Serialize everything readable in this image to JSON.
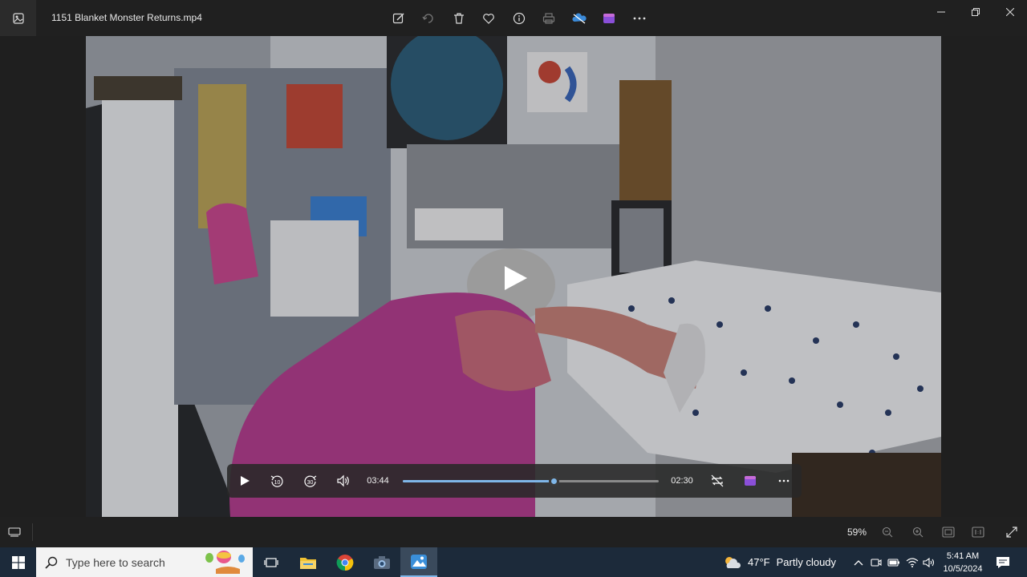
{
  "window": {
    "title": "1151 Blanket Monster Returns.mp4",
    "toolbar": [
      "edit-icon",
      "rotate-icon",
      "delete-icon",
      "favorite-icon",
      "info-icon",
      "print-icon",
      "onedrive-icon",
      "clipchamp-icon",
      "more-icon"
    ]
  },
  "player": {
    "elapsed": "03:44",
    "remaining": "02:30",
    "progress_fraction": 0.59,
    "skip_back": "10",
    "skip_forward": "30"
  },
  "statusbar": {
    "zoom": "59%"
  },
  "taskbar": {
    "search_placeholder": "Type here to search",
    "weather_temp": "47°F",
    "weather_text": "Partly cloudy",
    "time": "5:41 AM",
    "date": "10/5/2024"
  },
  "colors": {
    "accent": "#7fb6e8",
    "titlebar": "#202020",
    "taskbar": "#1c2a3a"
  }
}
